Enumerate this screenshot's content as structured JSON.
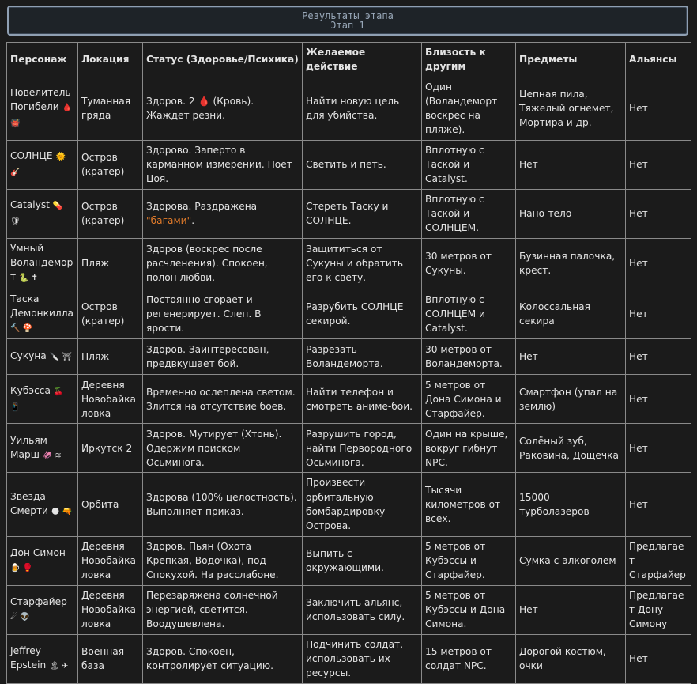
{
  "header": {
    "title": "Результаты этапа",
    "subtitle": "Этап 1"
  },
  "table": {
    "columns": [
      "Персонаж",
      "Локация",
      "Статус (Здоровье/Психика)",
      "Желаемое действие",
      "Близость к другим",
      "Предметы",
      "Альянсы"
    ],
    "rows": [
      {
        "name": "Повелитель Погибели",
        "emoji": "🩸 👹",
        "location": "Туманная гряда",
        "status": "Здоров. 2 🩸 (Кровь). Жаждет резни.",
        "action": "Найти новую цель для убийства.",
        "proximity": "Один (Воландеморт воскрес на пляже).",
        "items": "Цепная пила, Тяжелый огнемет, Мортира и др.",
        "alliance": "Нет"
      },
      {
        "name": "СОЛНЦЕ",
        "emoji": "🌞 🎸",
        "location": "Остров (кратер)",
        "status": "Здорово. Заперто в карманном измерении. Поет Цоя.",
        "action": "Светить и петь.",
        "proximity": "Вплотную с Таской и Catalyst.",
        "items": "Нет",
        "alliance": "Нет"
      },
      {
        "name": "Catalyst",
        "emoji": "💊 🛡",
        "location": "Остров (кратер)",
        "status_pre": "Здорова. Раздражена ",
        "status_hl": "\"багами\"",
        "status_post": ".",
        "action": "Стереть Таску и СОЛНЦЕ.",
        "proximity": "Вплотную с Таской и СОЛНЦЕМ.",
        "items": "Нано-тело",
        "alliance": "Нет"
      },
      {
        "name": "Умный Воландеморт",
        "emoji": "🐍 ✝",
        "location": "Пляж",
        "status": "Здоров (воскрес после расчленения). Спокоен, полон любви.",
        "action": "Защититься от Сукуны и обратить его к свету.",
        "proximity": "30 метров от Сукуны.",
        "items": "Бузинная палочка, крест.",
        "alliance": "Нет"
      },
      {
        "name": "Таска Демонкилла",
        "emoji": "🔨 🍄",
        "location": "Остров (кратер)",
        "status": "Постоянно сгорает и регенерирует. Слеп. В ярости.",
        "action": "Разрубить СОЛНЦЕ секирой.",
        "proximity": "Вплотную с СОЛНЦЕМ и Catalyst.",
        "items": "Колоссальная секира",
        "alliance": "Нет"
      },
      {
        "name": "Сукуна",
        "emoji": "🔪 ⛩",
        "location": "Пляж",
        "status": "Здоров. Заинтересован, предвкушает бой.",
        "action": "Разрезать Воландеморта.",
        "proximity": "30 метров от Воландеморта.",
        "items": "Нет",
        "alliance": "Нет"
      },
      {
        "name": "Кубэсса",
        "emoji": "🍒 📱",
        "location": "Деревня Новобайкаловка",
        "status": "Временно ослеплена светом. Злится на отсутствие боев.",
        "action": "Найти телефон и смотреть аниме-бои.",
        "proximity": "5 метров от Дона Симона и Старфайер.",
        "items": "Смартфон (упал на землю)",
        "alliance": "Нет"
      },
      {
        "name": "Уильям Марш",
        "emoji": "🦑 ≋",
        "location": "Иркутск 2",
        "status": "Здоров. Мутирует (Хтонь). Одержим поиском Осьминога.",
        "action": "Разрушить город, найти Первородного Осьминога.",
        "proximity": "Один на крыше, вокруг гибнут NPC.",
        "items": "Солёный зуб, Раковина, Дощечка",
        "alliance": "Нет"
      },
      {
        "name": "Звезда Смерти",
        "emoji": "🌑 🔫",
        "location": "Орбита",
        "status": "Здорова (100% целостность). Выполняет приказ.",
        "action": "Произвести орбитальную бомбардировку Острова.",
        "proximity": "Тысячи километров от всех.",
        "items": "15000 турболазеров",
        "alliance": "Нет"
      },
      {
        "name": "Дон Симон",
        "emoji": "🍺 🥊",
        "location": "Деревня Новобайкаловка",
        "status": "Здоров. Пьян (Охота Крепкая, Водочка), под Спокухой. На расслабоне.",
        "action": "Выпить с окружающими.",
        "proximity": "5 метров от Кубэссы и Старфайер.",
        "items": "Сумка с алкоголем",
        "alliance": "Предлагает Старфайер"
      },
      {
        "name": "Старфайер",
        "emoji": "☄ 👽",
        "location": "Деревня Новобайкаловка",
        "status": "Перезаряжена солнечной энергией, светится. Воодушевлена.",
        "action": "Заключить альянс, использовать силу.",
        "proximity": "5 метров от Кубэссы и Дона Симона.",
        "items": "Нет",
        "alliance": "Предлагает Дону Симону"
      },
      {
        "name": "Jeffrey Epstein",
        "emoji": "🏝 ✈",
        "location": "Военная база",
        "status": "Здоров. Спокоен, контролирует ситуацию.",
        "action": "Подчинить солдат, использовать их ресурсы.",
        "proximity": "15 метров от солдат NPC.",
        "items": "Дорогой костюм, очки",
        "alliance": "Нет"
      }
    ]
  }
}
